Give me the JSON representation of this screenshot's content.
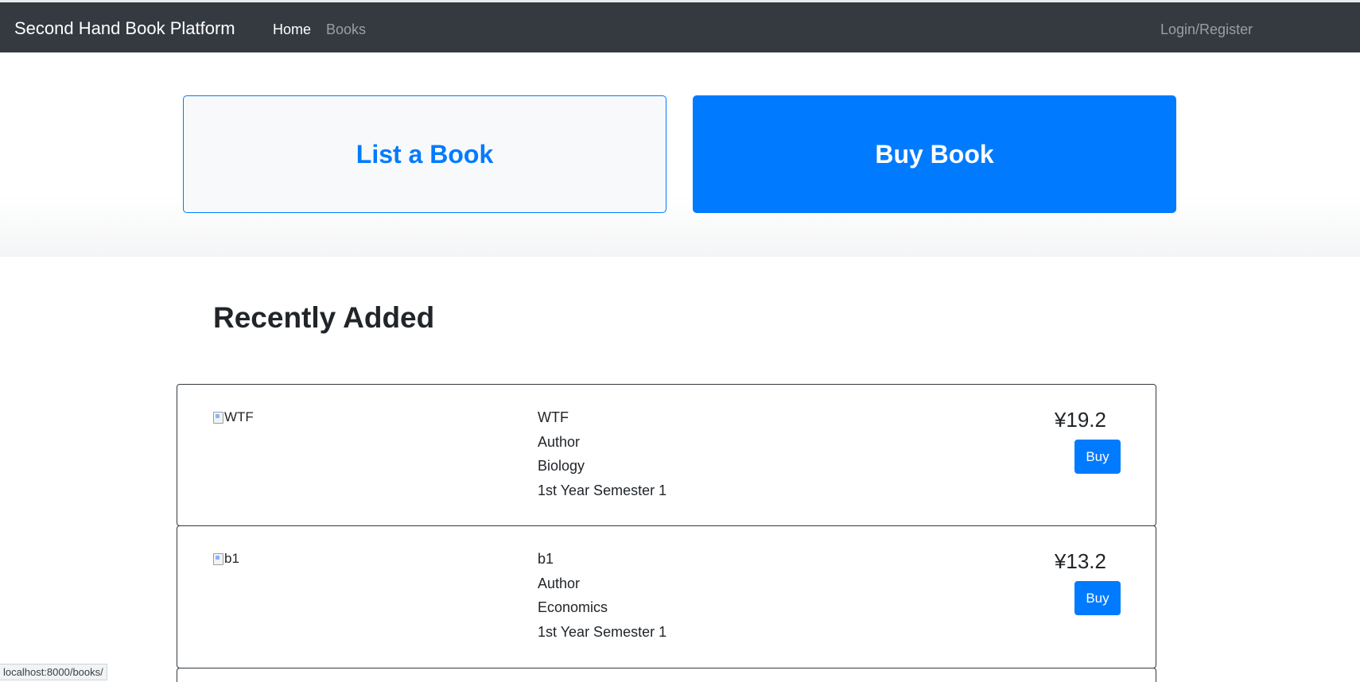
{
  "navbar": {
    "brand": "Second Hand Book Platform",
    "links": [
      {
        "label": "Home",
        "active": true
      },
      {
        "label": "Books",
        "active": false
      }
    ],
    "login_label": "Login/Register"
  },
  "hero": {
    "list_book_label": "List a Book",
    "buy_book_label": "Buy Book"
  },
  "recent": {
    "title": "Recently Added",
    "books": [
      {
        "image_alt": "WTF",
        "title": "WTF",
        "author": "Author",
        "subject": "Biology",
        "semester": "1st Year Semester 1",
        "price": "¥19.2",
        "buy_label": "Buy"
      },
      {
        "image_alt": "b1",
        "title": "b1",
        "author": "Author",
        "subject": "Economics",
        "semester": "1st Year Semester 1",
        "price": "¥13.2",
        "buy_label": "Buy"
      }
    ]
  },
  "status_bar": {
    "url": "localhost:8000/books/"
  },
  "colors": {
    "navbar_bg": "#343a40",
    "primary": "#007bff",
    "light_bg": "#f8f9fa"
  }
}
